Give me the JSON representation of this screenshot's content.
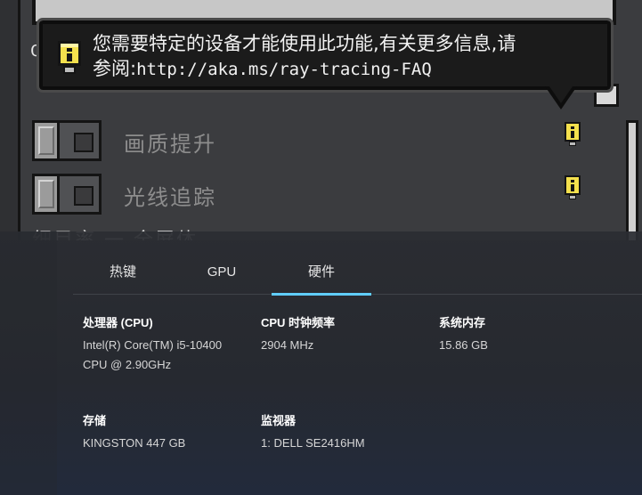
{
  "game": {
    "cut_label": "C",
    "settings": [
      {
        "label": "画质提升"
      },
      {
        "label": "光线追踪"
      }
    ],
    "bottom_cut_label": "细目率 一 全屏体"
  },
  "tooltip": {
    "line1": "您需要特定的设备才能使用此功能,有关更多信息,请",
    "line2_prefix": "参阅:",
    "url": "http://aka.ms/ray-tracing-FAQ"
  },
  "overlay": {
    "tabs": [
      {
        "label": "热键"
      },
      {
        "label": "GPU"
      },
      {
        "label": "硬件",
        "active": true
      }
    ],
    "hardware": {
      "cpu": {
        "label": "处理器 (CPU)",
        "value_line1": "Intel(R) Core(TM) i5-10400",
        "value_line2": "CPU @ 2.90GHz"
      },
      "cpu_clock": {
        "label": "CPU 时钟频率",
        "value": "2904 MHz"
      },
      "memory": {
        "label": "系统内存",
        "value": "15.86 GB"
      },
      "storage": {
        "label": "存储",
        "value": "KINGSTON 447 GB"
      },
      "monitor": {
        "label": "监视器",
        "value": "1: DELL SE2416HM"
      }
    },
    "colors": {
      "accent": "#60cdff"
    }
  }
}
